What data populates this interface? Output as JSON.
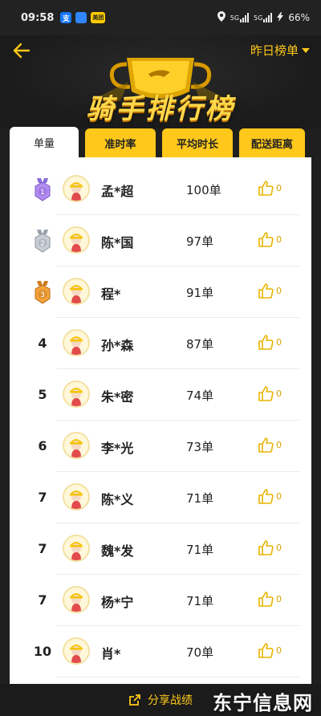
{
  "statusbar": {
    "time": "09:58",
    "apps": [
      "支",
      "●",
      "美团"
    ],
    "net": "5G",
    "battery": "66%"
  },
  "header": {
    "title": "骑手排行榜",
    "range_label": "昨日榜单"
  },
  "tabs": [
    {
      "label": "单量",
      "active": true
    },
    {
      "label": "准时率",
      "active": false
    },
    {
      "label": "平均时长",
      "active": false
    },
    {
      "label": "配送距离",
      "active": false
    }
  ],
  "riders": [
    {
      "rank": "1",
      "name": "孟*超",
      "orders": "100单",
      "likes": "0",
      "medal": "purple"
    },
    {
      "rank": "2",
      "name": "陈*国",
      "orders": "97单",
      "likes": "0",
      "medal": "silver"
    },
    {
      "rank": "3",
      "name": "程*",
      "orders": "91单",
      "likes": "0",
      "medal": "bronze"
    },
    {
      "rank": "4",
      "name": "孙*森",
      "orders": "87单",
      "likes": "0"
    },
    {
      "rank": "5",
      "name": "朱*密",
      "orders": "74单",
      "likes": "0"
    },
    {
      "rank": "6",
      "name": "李*光",
      "orders": "73单",
      "likes": "0"
    },
    {
      "rank": "7",
      "name": "陈*义",
      "orders": "71单",
      "likes": "0"
    },
    {
      "rank": "7",
      "name": "魏*发",
      "orders": "71单",
      "likes": "0"
    },
    {
      "rank": "7",
      "name": "杨*宁",
      "orders": "71单",
      "likes": "0"
    },
    {
      "rank": "10",
      "name": "肖*",
      "orders": "70单",
      "likes": "0"
    }
  ],
  "bottom": {
    "share_label": "分享战绩",
    "watermark": "东宁信息网"
  },
  "colors": {
    "accent": "#ffc81a",
    "background": "#1f1f1f",
    "list_bg": "#ffffff"
  }
}
